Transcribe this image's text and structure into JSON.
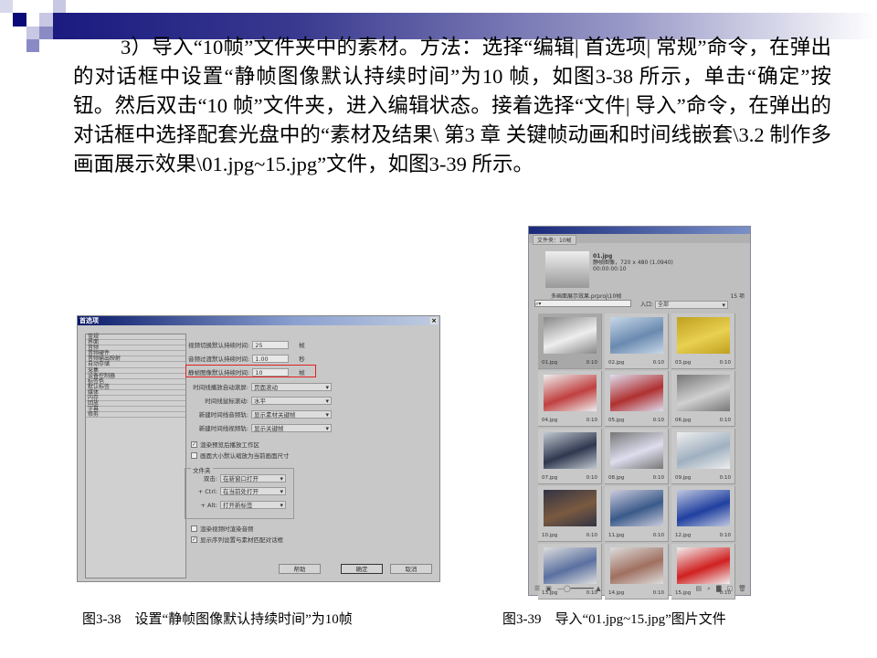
{
  "paragraph": "3）导入“10帧”文件夹中的素材。方法：选择“编辑| 首选项| 常规”命令，在弹出的对话框中设置“静帧图像默认持续时间”为10 帧，如图3-38 所示，单击“确定”按钮。然后双击“10 帧”文件夹，进入编辑状态。接着选择“文件| 导入”命令，在弹出的对话框中选择配套光盘中的“素材及结果\\ 第3 章 关键帧动画和时间线嵌套\\3.2 制作多画面展示效果\\01.jpg~15.jpg”文件，如图3-39 所示。",
  "dialog": {
    "title": "首选项",
    "close": "×",
    "categories": [
      "常规",
      "界面",
      "音频",
      "音频硬件",
      "音频输出映射",
      "自动存储",
      "采集",
      "设备控制器",
      "标签色",
      "默认标签",
      "媒体",
      "内存",
      "回放",
      "字幕",
      "修剪"
    ],
    "fields": [
      {
        "label": "视频切换默认持续时间:",
        "value": "25",
        "unit": "帧"
      },
      {
        "label": "音频过渡默认持续时间:",
        "value": "1.00",
        "unit": "秒"
      },
      {
        "label": "静帧图像默认持续时间:",
        "value": "10",
        "unit": "帧"
      }
    ],
    "selects": [
      {
        "label": "时间线播放自动滚屏:",
        "value": "页面滚动"
      },
      {
        "label": "时间线鼠标滚动:",
        "value": "水平"
      },
      {
        "label": "新建时间线音频轨:",
        "value": "显示素材关键帧"
      },
      {
        "label": "新建时间线视频轨:",
        "value": "显示关键帧"
      }
    ],
    "checks": [
      {
        "label": "渲染预览后播放工作区",
        "checked": true
      },
      {
        "label": "画面大小默认缩放为当前画面尺寸",
        "checked": false
      }
    ],
    "folder_group": "文件夹",
    "folder": [
      {
        "label": "双击:",
        "value": "在新窗口打开"
      },
      {
        "label": "+ Ctrl:",
        "value": "在当前处打开"
      },
      {
        "label": "+ Alt:",
        "value": "打开新标签"
      }
    ],
    "checks2": [
      {
        "label": "渲染视频时渲染音频",
        "checked": false
      },
      {
        "label": "显示序列设置与素材匹配对话框",
        "checked": true
      }
    ],
    "buttons": {
      "help": "帮助",
      "ok": "确定",
      "cancel": "取消"
    },
    "highlight_color": "#e02020"
  },
  "panel": {
    "tab": "文件夹：10帧",
    "preview_name": "01.jpg",
    "preview_info": "静帧图像，720 x 480 (1.0940)",
    "preview_time": "00:00:00:10",
    "project": "多画面展示效果.prproj\\10帧",
    "count": "15 项",
    "entry_label": "入口:",
    "entry_value": "全部",
    "items": [
      "01.jpg",
      "02.jpg",
      "03.jpg",
      "04.jpg",
      "05.jpg",
      "06.jpg",
      "07.jpg",
      "08.jpg",
      "09.jpg",
      "10.jpg",
      "11.jpg",
      "12.jpg",
      "13.jpg",
      "14.jpg",
      "15.jpg"
    ],
    "duration": "0:10"
  },
  "captions": {
    "fig38": "图3-38　设置“静帧图像默认持续时间”为10帧",
    "fig39": "图3-39　导入“01.jpg~15.jpg”图片文件"
  }
}
